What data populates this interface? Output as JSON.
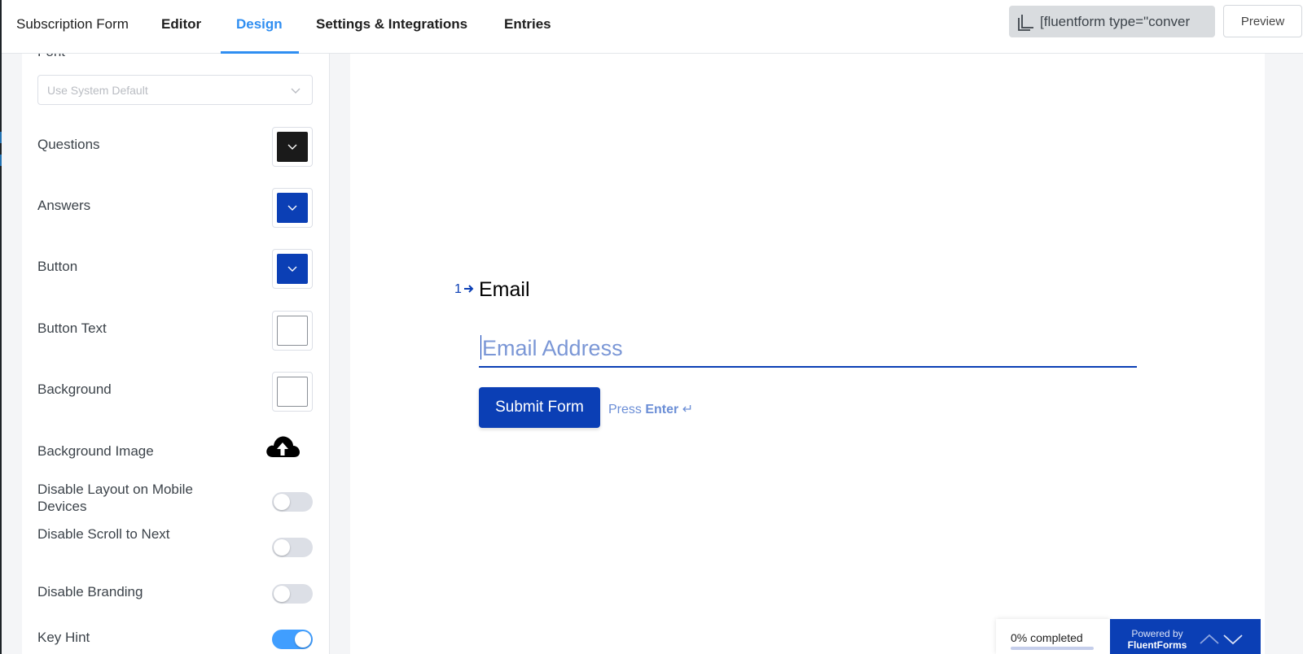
{
  "header": {
    "form_title": "Subscription Form",
    "tabs": [
      {
        "label": "Editor"
      },
      {
        "label": "Design"
      },
      {
        "label": "Settings & Integrations"
      },
      {
        "label": "Entries"
      }
    ],
    "active_tab": "Design",
    "shortcode": "[fluentform type=\"conver",
    "preview_label": "Preview"
  },
  "sidebar": {
    "font_label": "Font",
    "font_select_value": "Use System Default",
    "color_rows": [
      {
        "label": "Questions",
        "color": "#1a1a1a"
      },
      {
        "label": "Answers",
        "color": "#0b3fb5"
      },
      {
        "label": "Button",
        "color": "#0b3fb5"
      },
      {
        "label": "Button Text",
        "color": "#ffffff"
      },
      {
        "label": "Background",
        "color": "#ffffff"
      }
    ],
    "background_image_label": "Background Image",
    "toggles": [
      {
        "label": "Disable Layout on Mobile Devices",
        "on": false
      },
      {
        "label": "Disable Scroll to Next",
        "on": false
      },
      {
        "label": "Disable Branding",
        "on": false
      },
      {
        "label": "Key Hint",
        "on": true
      }
    ]
  },
  "preview": {
    "question_number": "1",
    "question_title": "Email",
    "input_placeholder": "Email Address",
    "submit_label": "Submit Form",
    "hint_press": "Press",
    "hint_key": "Enter",
    "hint_symbol": "↵",
    "progress_text": "0% completed",
    "progress_percent": 0,
    "branding_line1": "Powered by",
    "branding_line2": "FluentForms"
  },
  "colors": {
    "accent": "#2f8ef1",
    "brand": "#0b3fb5",
    "toggle_on": "#409eff"
  }
}
